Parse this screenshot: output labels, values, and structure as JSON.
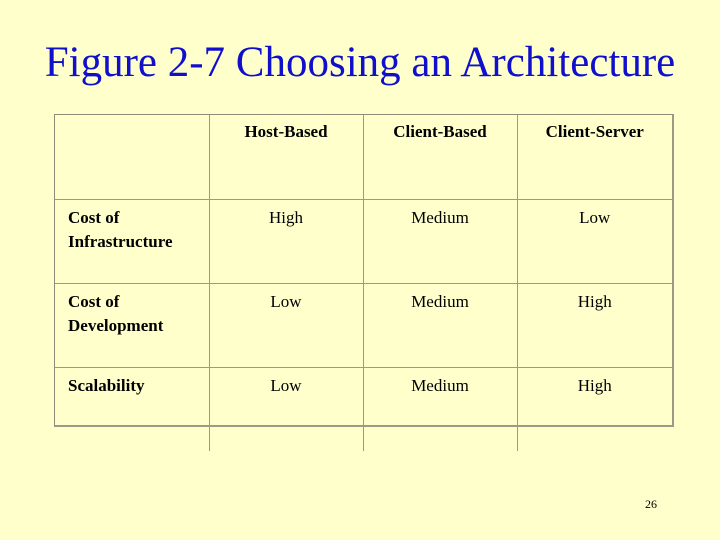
{
  "slide": {
    "title": "Figure 2-7 Choosing an Architecture",
    "page_number": "26",
    "colors": {
      "background": "#ffffcc",
      "title": "#0f0fcc",
      "grid_lines": "#9a9a8a"
    }
  },
  "table": {
    "corner": "",
    "columns": [
      "Host-Based",
      "Client-Based",
      "Client-Server"
    ],
    "rows": [
      {
        "label": "Cost of Infrastructure",
        "values": [
          "High",
          "Medium",
          "Low"
        ]
      },
      {
        "label": "Cost of Development",
        "values": [
          "Low",
          "Medium",
          "High"
        ]
      },
      {
        "label": "Scalability",
        "values": [
          "Low",
          "Medium",
          "High"
        ]
      }
    ]
  }
}
